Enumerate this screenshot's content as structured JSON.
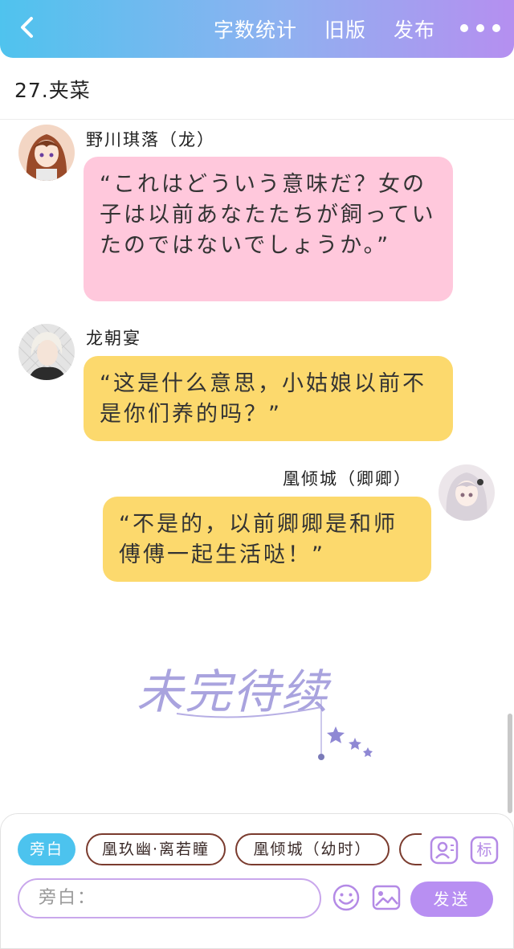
{
  "header": {
    "stats_label": "字数统计",
    "old_version_label": "旧版",
    "publish_label": "发布"
  },
  "chapter": {
    "title": "27.夹菜"
  },
  "messages": [
    {
      "speaker": "野川琪落（龙）",
      "text": "“これはどういう意味だ？女の子は以前あなたたちが飼っていたのではないでしょうか。”",
      "color": "#ffc8dc"
    },
    {
      "speaker": "龙朝宴",
      "text": "“这是什么意思，小姑娘以前不是你们养的吗？”",
      "color": "#fcd96d"
    },
    {
      "speaker": "凰倾城（卿卿）",
      "text": "“不是的，以前卿卿是和师傅傅一起生活哒！”",
      "color": "#fcd96d"
    }
  ],
  "watermark": {
    "text": "未完待续"
  },
  "bottom": {
    "chips": [
      "旁白",
      "凰玖幽·离若瞳",
      "凰倾城（幼时）"
    ],
    "tag_label": "标",
    "input_placeholder": "旁白：",
    "send_label": "发送"
  },
  "colors": {
    "accent_blue": "#4cc3ee",
    "accent_purple": "#b88ff2",
    "pink_bubble": "#ffc8dc",
    "yellow_bubble": "#fcd96d"
  }
}
